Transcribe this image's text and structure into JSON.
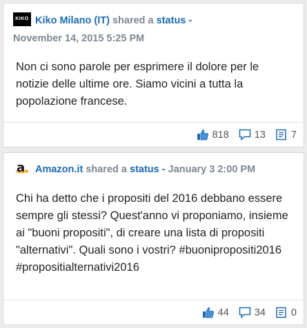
{
  "posts": [
    {
      "avatar_text": "KIKO",
      "author": "Kiko Milano (IT)",
      "action": "shared a",
      "object": "status",
      "separator": "-",
      "timestamp": "November 14, 2015 5:25 PM",
      "body": "Non ci sono parole per esprimere il dolore per le notizie delle ultime ore. Siamo vicini a tutta la popolazione francese.",
      "likes": "818",
      "comments": "13",
      "shares": "7"
    },
    {
      "avatar_text": "a",
      "author": "Amazon.it",
      "action": "shared a",
      "object": "status",
      "separator": "-",
      "timestamp": "January 3 2:00 PM",
      "body": "Chi ha detto che i propositi del 2016 debbano essere sempre gli stessi? Quest'anno vi proponiamo, insieme ai \"buoni propositi\", di creare una lista di propositi \"alternativi\". Quali sono i vostri? #buonipropositi2016 #propositialternativi2016",
      "likes": "44",
      "comments": "34",
      "shares": "0"
    }
  ],
  "colors": {
    "link": "#1c6bb0",
    "muted": "#7d8794",
    "icon": "#1c6bb0"
  },
  "icons": [
    "thumbs-up-icon",
    "comment-icon",
    "share-icon"
  ]
}
